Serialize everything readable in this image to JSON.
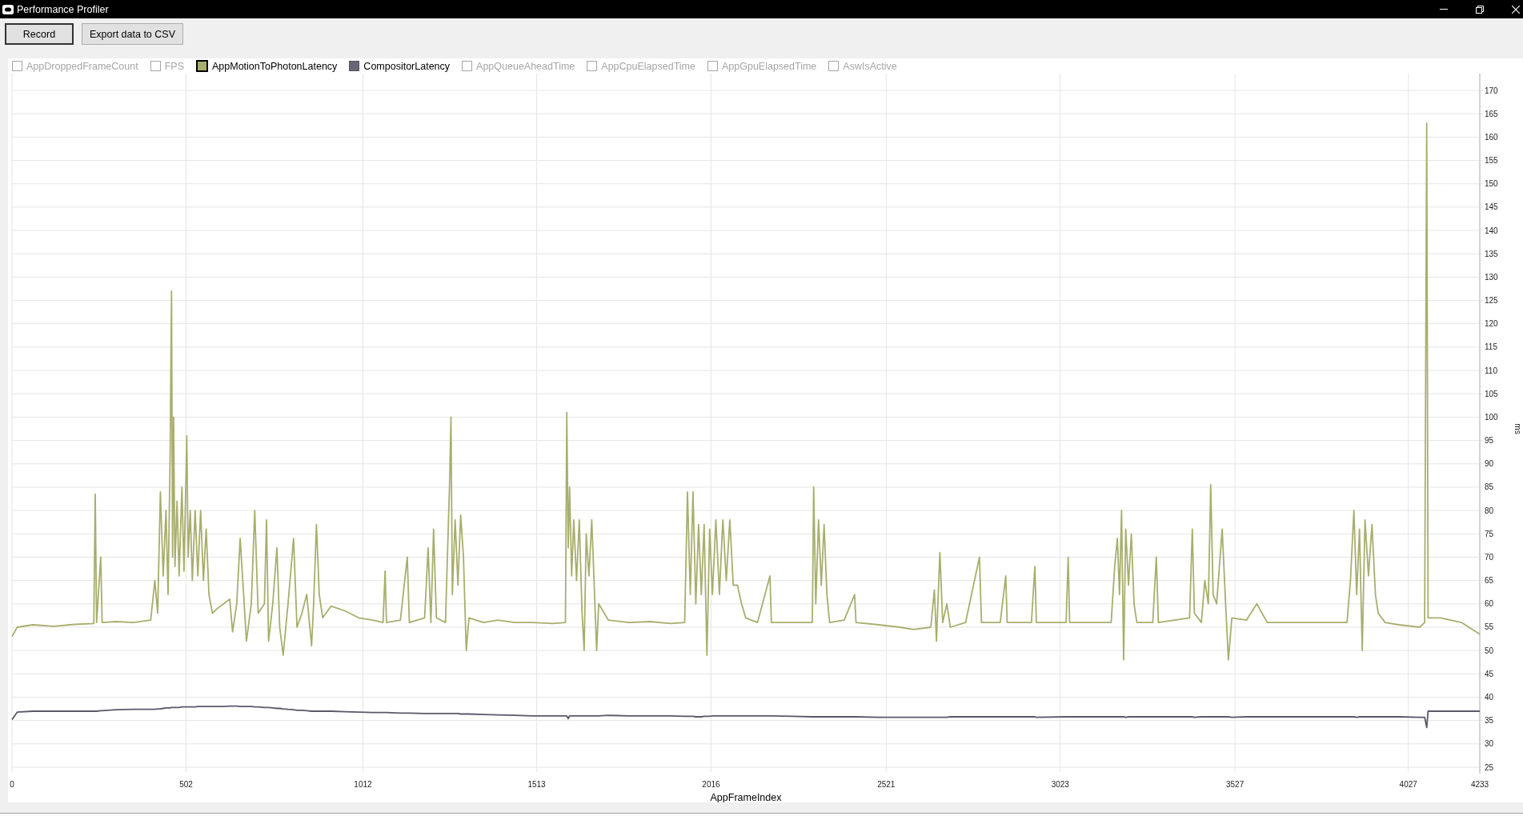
{
  "window": {
    "title": "Performance Profiler"
  },
  "toolbar": {
    "buttons": [
      {
        "label": "Record",
        "default": true
      },
      {
        "label": "Export data to CSV",
        "default": false
      }
    ]
  },
  "legend": [
    {
      "label": "AppDroppedFrameCount",
      "checked": false,
      "focused": false
    },
    {
      "label": "FPS",
      "checked": false,
      "focused": false
    },
    {
      "label": "AppMotionToPhotonLatency",
      "checked": true,
      "focused": true,
      "color": "#a9ae6b"
    },
    {
      "label": "CompositorLatency",
      "checked": true,
      "focused": false,
      "color": "#676577"
    },
    {
      "label": "AppQueueAheadTime",
      "checked": false,
      "focused": false
    },
    {
      "label": "AppCpuElapsedTime",
      "checked": false,
      "focused": false
    },
    {
      "label": "AppGpuElapsedTime",
      "checked": false,
      "focused": false
    },
    {
      "label": "AswIsActive",
      "checked": false,
      "focused": false
    }
  ],
  "chart": {
    "chart_data": {
      "type": "line",
      "grid": true,
      "xlabel": "AppFrameIndex",
      "ylabel": "ms",
      "xlim": [
        0,
        4233
      ],
      "ylim": [
        25,
        170
      ],
      "xticks": [
        0,
        502,
        1012,
        1513,
        2016,
        2521,
        3023,
        3527,
        4027,
        4233
      ],
      "yticks": [
        25,
        30,
        35,
        40,
        45,
        50,
        55,
        60,
        65,
        70,
        75,
        80,
        85,
        90,
        95,
        100,
        105,
        110,
        115,
        120,
        125,
        130,
        135,
        140,
        145,
        150,
        155,
        160,
        165,
        170
      ],
      "x": [
        0,
        15,
        60,
        120,
        180,
        236,
        240,
        244,
        256,
        260,
        300,
        350,
        400,
        412,
        420,
        428,
        436,
        444,
        450,
        456,
        460,
        463,
        466,
        470,
        476,
        482,
        490,
        496,
        504,
        508,
        514,
        520,
        528,
        536,
        544,
        552,
        560,
        568,
        578,
        592,
        610,
        628,
        636,
        648,
        658,
        668,
        676,
        690,
        700,
        710,
        728,
        734,
        740,
        752,
        764,
        772,
        782,
        796,
        812,
        822,
        836,
        850,
        864,
        870,
        878,
        886,
        896,
        920,
        960,
        1000,
        1040,
        1070,
        1076,
        1080,
        1120,
        1140,
        1146,
        1190,
        1200,
        1208,
        1216,
        1224,
        1250,
        1262,
        1266,
        1270,
        1278,
        1286,
        1294,
        1302,
        1310,
        1318,
        1360,
        1400,
        1450,
        1500,
        1560,
        1596,
        1600,
        1604,
        1608,
        1614,
        1620,
        1628,
        1636,
        1644,
        1650,
        1656,
        1664,
        1672,
        1680,
        1686,
        1692,
        1720,
        1780,
        1840,
        1900,
        1940,
        1948,
        1956,
        1964,
        1972,
        1980,
        1988,
        1996,
        2004,
        2012,
        2020,
        2030,
        2040,
        2050,
        2060,
        2070,
        2080,
        2092,
        2104,
        2116,
        2150,
        2186,
        2190,
        2250,
        2308,
        2312,
        2318,
        2326,
        2334,
        2342,
        2350,
        2358,
        2400,
        2430,
        2434,
        2500,
        2560,
        2600,
        2650,
        2660,
        2666,
        2676,
        2684,
        2696,
        2706,
        2750,
        2790,
        2796,
        2850,
        2866,
        2870,
        2940,
        2950,
        2954,
        3040,
        3046,
        3050,
        3170,
        3180,
        3188,
        3194,
        3200,
        3206,
        3212,
        3220,
        3228,
        3236,
        3244,
        3290,
        3300,
        3306,
        3396,
        3404,
        3410,
        3430,
        3440,
        3450,
        3457,
        3464,
        3474,
        3490,
        3500,
        3508,
        3518,
        3560,
        3590,
        3620,
        3680,
        3740,
        3800,
        3850,
        3860,
        3870,
        3878,
        3886,
        3894,
        3902,
        3912,
        3922,
        3932,
        3940,
        3960,
        4000,
        4060,
        4074,
        4080,
        4084,
        4120,
        4180,
        4233
      ],
      "series": [
        {
          "color": "#a8ae6c",
          "values": [
            53,
            55,
            55.5,
            55.2,
            55.6,
            55.8,
            83.5,
            56,
            70,
            56,
            56.2,
            56,
            56.5,
            65,
            58,
            84,
            66,
            80,
            62,
            92,
            127,
            70,
            100,
            68,
            82,
            66,
            85,
            67,
            96,
            70,
            80,
            65,
            80,
            66,
            80,
            65,
            76,
            62,
            58,
            59,
            60,
            61,
            54,
            60,
            74,
            62,
            52,
            60,
            80,
            58,
            60,
            78,
            52,
            60,
            72,
            55,
            49,
            60,
            74,
            55,
            58,
            62,
            51,
            60,
            77,
            62,
            57,
            59.5,
            58.5,
            57,
            56.5,
            56,
            67,
            56,
            56.5,
            70,
            56,
            57,
            72,
            56,
            76,
            57,
            56,
            86,
            100,
            62,
            78,
            64,
            79,
            70,
            50,
            57,
            56,
            56.5,
            56,
            56,
            55.8,
            56,
            101,
            72,
            85,
            66,
            78,
            65,
            78,
            58,
            50,
            75,
            66,
            78,
            62,
            50,
            60,
            56.5,
            56,
            56.2,
            55.8,
            56,
            84,
            62,
            84,
            60,
            77,
            62,
            77,
            49,
            76,
            62,
            78,
            62,
            78,
            65,
            78,
            64,
            64,
            60,
            57,
            56,
            66,
            56,
            56,
            56,
            85,
            60,
            78,
            64,
            77,
            62,
            56,
            56.5,
            62,
            56,
            55.5,
            55,
            54.5,
            55,
            63,
            52,
            71,
            56,
            60,
            55,
            56,
            70,
            56,
            56,
            66,
            56,
            56,
            68,
            56,
            56,
            70,
            56,
            56,
            68,
            74,
            62,
            80,
            48,
            76,
            64,
            75,
            60,
            56,
            56,
            70,
            56,
            57,
            76,
            58,
            56,
            65,
            60,
            85.5,
            62,
            60,
            76,
            60,
            48,
            57,
            56.5,
            60,
            56,
            56,
            56,
            56,
            56,
            65,
            80,
            62,
            76,
            50,
            78,
            66,
            77,
            62,
            58,
            56,
            55.5,
            55,
            56,
            163,
            57,
            57,
            56,
            53.5
          ]
        },
        {
          "color": "#5a5868",
          "values": [
            35.2,
            36.8,
            37,
            37,
            37,
            37,
            37,
            37,
            37.1,
            37.1,
            37.3,
            37.4,
            37.4,
            37.4,
            37.5,
            37.5,
            37.6,
            37.7,
            37.7,
            37.7,
            37.8,
            37.8,
            37.8,
            37.8,
            37.8,
            37.8,
            37.9,
            37.9,
            37.9,
            37.9,
            37.9,
            37.9,
            37.9,
            38,
            38,
            38,
            38,
            38,
            38,
            38,
            38,
            38.1,
            38.1,
            38.1,
            38,
            38,
            38,
            38,
            37.9,
            37.9,
            37.8,
            37.8,
            37.8,
            37.7,
            37.6,
            37.6,
            37.5,
            37.4,
            37.3,
            37.2,
            37.2,
            37.1,
            37,
            37,
            37,
            37,
            37,
            37,
            36.9,
            36.8,
            36.7,
            36.7,
            36.7,
            36.7,
            36.6,
            36.6,
            36.6,
            36.5,
            36.5,
            36.5,
            36.5,
            36.5,
            36.5,
            36.5,
            36.5,
            36.5,
            36.5,
            36.5,
            36.4,
            36.4,
            36.4,
            36.4,
            36.3,
            36.2,
            36.1,
            36,
            36,
            36,
            36,
            35.4,
            36,
            36,
            36,
            36,
            36,
            36,
            36,
            36,
            36,
            36,
            36,
            36,
            36,
            36.1,
            36,
            36,
            36,
            35.9,
            35.9,
            35.9,
            35.9,
            35.8,
            35.8,
            35.8,
            35.9,
            35.9,
            35.9,
            36,
            36,
            36,
            36,
            36,
            36,
            36,
            36,
            36,
            36,
            36,
            36,
            36,
            35.9,
            35.8,
            35.8,
            35.8,
            35.8,
            35.8,
            35.8,
            35.8,
            35.8,
            35.8,
            35.8,
            35.8,
            35.7,
            35.7,
            35.7,
            35.7,
            35.7,
            35.7,
            35.7,
            35.7,
            35.7,
            35.8,
            35.8,
            35.8,
            35.8,
            35.8,
            35.8,
            35.8,
            35.8,
            35.8,
            35.7,
            35.8,
            35.8,
            35.8,
            35.8,
            35.8,
            35.8,
            35.8,
            35.8,
            35.8,
            35.7,
            35.8,
            35.8,
            35.8,
            35.8,
            35.8,
            35.8,
            35.8,
            35.8,
            35.8,
            35.7,
            35.8,
            35.8,
            35.8,
            35.8,
            35.8,
            35.8,
            35.8,
            35.8,
            35.8,
            35.7,
            35.8,
            35.8,
            35.8,
            35.8,
            35.8,
            35.8,
            35.8,
            35.8,
            35.8,
            35.7,
            35.8,
            35.8,
            35.8,
            35.8,
            35.8,
            35.8,
            35.8,
            35.8,
            35.8,
            35.7,
            35.7,
            33.5,
            37,
            37,
            37,
            37
          ]
        }
      ]
    }
  }
}
